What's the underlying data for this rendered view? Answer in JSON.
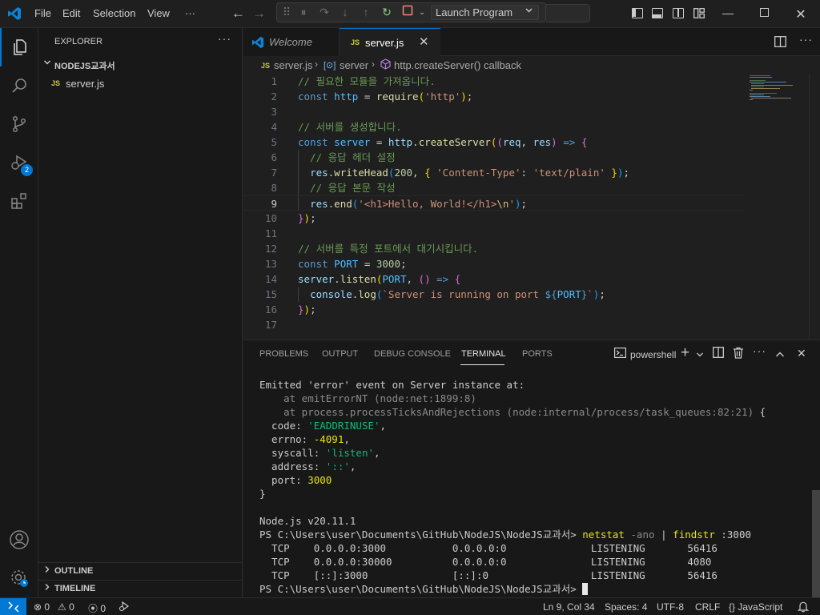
{
  "titlebar": {
    "menu": [
      "File",
      "Edit",
      "Selection",
      "View",
      "···"
    ],
    "launch_config": "Launch Program"
  },
  "activity": {
    "debug_badge": "2"
  },
  "sidebar": {
    "title": "EXPLORER",
    "more": "···",
    "folder": "NODEJS교과서",
    "files": [
      {
        "icon": "JS",
        "name": "server.js"
      }
    ],
    "outline": "OUTLINE",
    "timeline": "TIMELINE"
  },
  "tabs": [
    {
      "label": "Welcome",
      "active": false
    },
    {
      "label": "server.js",
      "icon": "JS",
      "active": true
    }
  ],
  "breadcrumb": {
    "file": "server.js",
    "symbol1": "server",
    "symbol2": "http.createServer() callback"
  },
  "editor": {
    "current_line": 9,
    "lines": [
      "// 필요한 모듈을 가져옵니다.",
      "const http = require('http');",
      "",
      "// 서버를 생성합니다.",
      "const server = http.createServer((req, res) => {",
      "  // 응답 헤더 설정",
      "  res.writeHead(200, { 'Content-Type': 'text/plain' });",
      "  // 응답 본문 작성",
      "  res.end('<h1>Hello, World!</h1>\\n');",
      "});",
      "",
      "// 서버를 특정 포트에서 대기시킵니다.",
      "const PORT = 3000;",
      "server.listen(PORT, () => {",
      "  console.log(`Server is running on port ${PORT}`);",
      "});",
      ""
    ]
  },
  "panel": {
    "tabs": [
      "PROBLEMS",
      "OUTPUT",
      "DEBUG CONSOLE",
      "TERMINAL",
      "PORTS"
    ],
    "active_tab": "TERMINAL",
    "shell": "powershell",
    "terminal": {
      "error_header": "Emitted 'error' event on Server instance at:",
      "stack1": "    at emitErrorNT (node:net:1899:8)",
      "stack2": "    at process.processTicksAndRejections (node:internal/process/task_queues:82:21) {",
      "code_key": "  code: ",
      "code_val": "'EADDRINUSE'",
      "errno_key": "  errno: ",
      "errno_val": "-4091",
      "syscall_key": "  syscall: ",
      "syscall_val": "'listen'",
      "address_key": "  address: ",
      "address_val": "'::'",
      "port_key": "  port: ",
      "port_val": "3000",
      "close": "}",
      "node_version": "Node.js v20.11.1",
      "prompt": "PS C:\\Users\\user\\Documents\\GitHub\\NodeJS\\NodeJS교과서> ",
      "cmd_name": "netstat",
      "cmd_args1": " -ano ",
      "cmd_pipe": "| ",
      "cmd_find": "findstr",
      "cmd_args2": " :3000",
      "netstat_rows": [
        "  TCP    0.0.0.0:3000           0.0.0.0:0              LISTENING       56416",
        "  TCP    0.0.0.0:30000          0.0.0.0:0              LISTENING       4080",
        "  TCP    [::]:3000              [::]:0                 LISTENING       56416"
      ]
    }
  },
  "statusbar": {
    "errors": "0",
    "warnings": "0",
    "ports": "0",
    "cursor": "Ln 9, Col 34",
    "spaces": "Spaces: 4",
    "encoding": "UTF-8",
    "eol": "CRLF",
    "language_braces": "{}",
    "language": "JavaScript"
  },
  "colors": {
    "accent": "#0078d4",
    "background": "#1f1f1f",
    "sidebar": "#181818"
  }
}
